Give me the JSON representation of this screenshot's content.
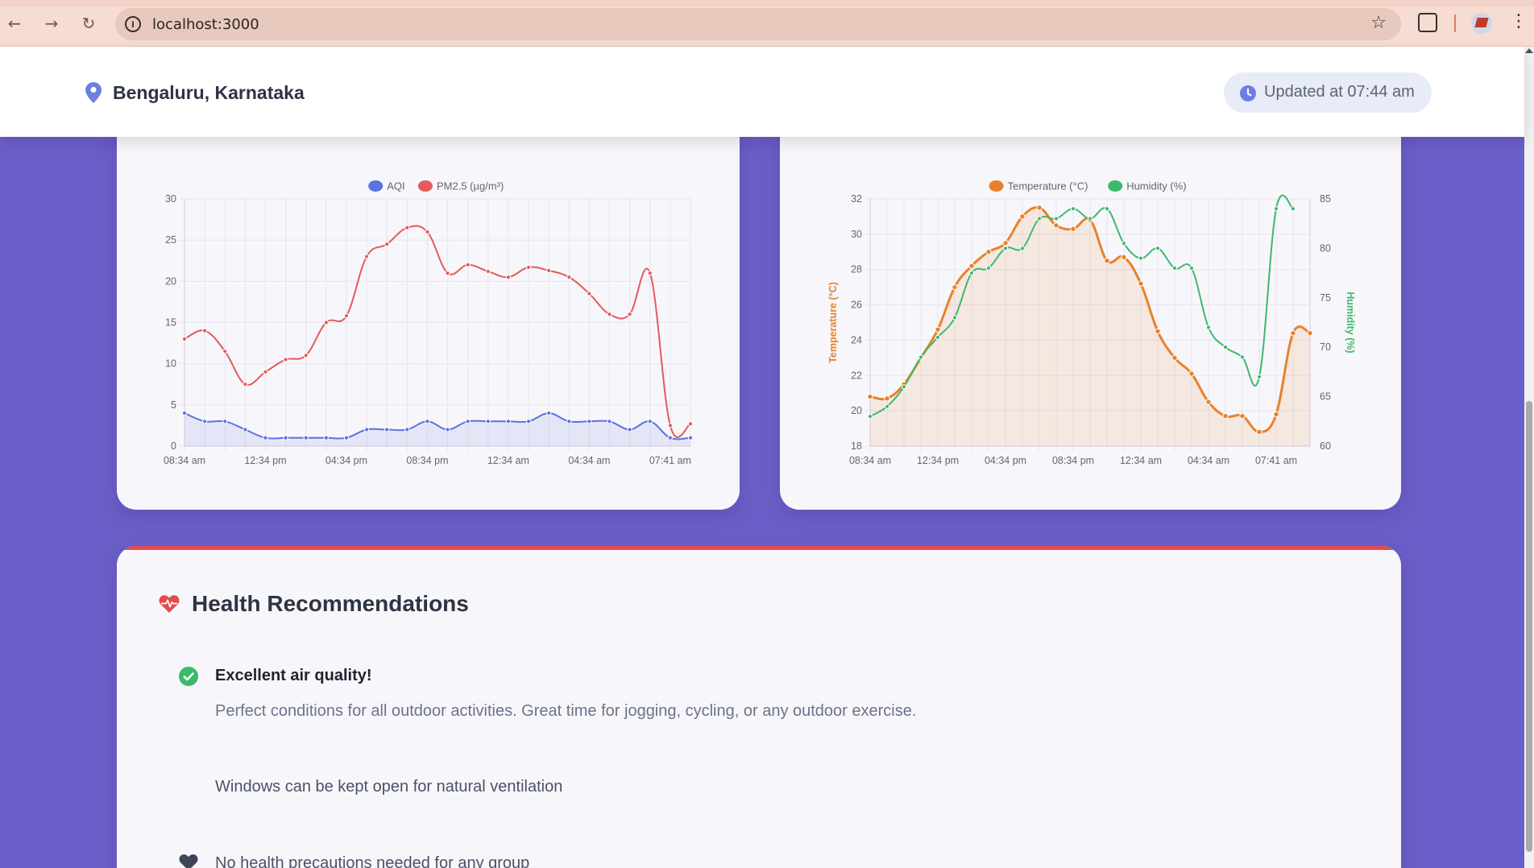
{
  "browser": {
    "url": "localhost:3000",
    "icons": [
      "back-arrow-icon",
      "forward-arrow-icon",
      "reload-icon",
      "site-info-icon",
      "bookmark-star-icon",
      "extensions-icon",
      "profile-avatar",
      "menu-kebab-icon"
    ]
  },
  "header": {
    "location": "Bengaluru, Karnataka",
    "updated": "Updated at 07:44 am",
    "location_icon": "map-pin-icon",
    "clock_icon": "clock-icon",
    "accent_color": "#6d7ee0"
  },
  "charts": [
    {
      "id": "aqi-pm25"
    },
    {
      "id": "temp-humidity"
    }
  ],
  "chart_data": [
    {
      "type": "line",
      "title": "",
      "xlabel": "",
      "ylabel": "",
      "x_ticks": [
        "08:34 am",
        "12:34 pm",
        "04:34 pm",
        "08:34 pm",
        "12:34 am",
        "04:34 am",
        "07:41 am"
      ],
      "x_tick_index": [
        0,
        4,
        8,
        12,
        16,
        20,
        24
      ],
      "ylim": [
        0,
        30
      ],
      "y_ticks": [
        0,
        5,
        10,
        15,
        20,
        25,
        30
      ],
      "grid": true,
      "legend": "top-center",
      "series": [
        {
          "name": "AQI",
          "color": "#5a73e0",
          "fill": true,
          "values": [
            4,
            3,
            3,
            2,
            1,
            1,
            1,
            1,
            1,
            2,
            2,
            2,
            3,
            2,
            3,
            3,
            3,
            3,
            4,
            3,
            3,
            3,
            2,
            3,
            1,
            1
          ]
        },
        {
          "name": "PM2.5 (µg/m³)",
          "color": "#e55a5a",
          "fill": false,
          "values": [
            13,
            14,
            11.5,
            7.5,
            9,
            10.5,
            11,
            15,
            15.8,
            23,
            24.5,
            26.5,
            26,
            21,
            22,
            21.2,
            20.5,
            21.7,
            21.3,
            20.5,
            18.5,
            16,
            16,
            21,
            2.5,
            2.7
          ]
        }
      ]
    },
    {
      "type": "line",
      "title": "",
      "xlabel": "",
      "ylabel": "Temperature (°C)",
      "y2label": "Humidity (%)",
      "x_ticks": [
        "08:34 am",
        "12:34 pm",
        "04:34 pm",
        "08:34 pm",
        "12:34 am",
        "04:34 am",
        "07:41 am"
      ],
      "x_tick_index": [
        0,
        4,
        8,
        12,
        16,
        20,
        24
      ],
      "ylim": [
        18,
        32
      ],
      "y_ticks": [
        18,
        20,
        22,
        24,
        26,
        28,
        30,
        32
      ],
      "y2lim": [
        60,
        85
      ],
      "y2_ticks": [
        60,
        65,
        70,
        75,
        80,
        85
      ],
      "grid": true,
      "legend": "top-center",
      "series": [
        {
          "name": "Temperature (°C)",
          "axis": "left",
          "color": "#e8822a",
          "fill": true,
          "values": [
            20.8,
            20.7,
            21.5,
            23,
            24.6,
            27,
            28.2,
            29,
            29.5,
            31,
            31.5,
            30.5,
            30.3,
            30.8,
            28.5,
            28.7,
            27.2,
            24.5,
            23,
            22.1,
            20.5,
            19.7,
            19.7,
            18.8,
            19.8,
            24.4,
            24.4
          ]
        },
        {
          "name": "Humidity (%)",
          "axis": "right",
          "color": "#3cba6b",
          "fill": false,
          "values": [
            63,
            64,
            66,
            69,
            71,
            73,
            77.5,
            78,
            80,
            80,
            83,
            83,
            84,
            83,
            84,
            80.5,
            79,
            80,
            78,
            78,
            72,
            70,
            69,
            67,
            84,
            84
          ]
        }
      ]
    }
  ],
  "health": {
    "title": "Health Recommendations",
    "title_icon": "heart-pulse-icon",
    "accent_color": "#e24c4c",
    "items": [
      {
        "icon": "check-circle-icon",
        "title": "Excellent air quality!",
        "description": "Perfect conditions for all outdoor activities. Great time for jogging, cycling, or any outdoor exercise."
      },
      {
        "text": "Windows can be kept open for natural ventilation"
      },
      {
        "icon": "heart-icon",
        "text": "No health precautions needed for any group"
      }
    ]
  }
}
